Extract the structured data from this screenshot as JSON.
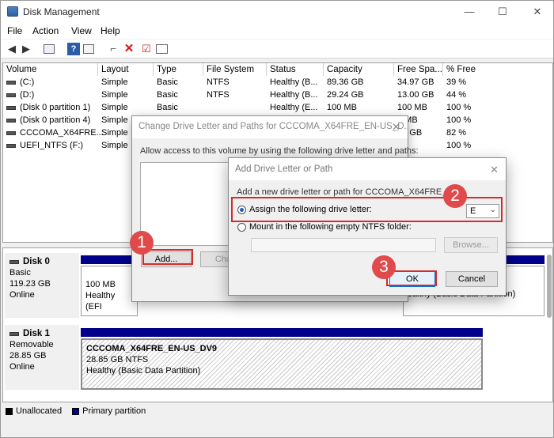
{
  "window": {
    "title": "Disk Management",
    "minimize": "—",
    "maximize": "☐",
    "close": "✕"
  },
  "menu": [
    "File",
    "Action",
    "View",
    "Help"
  ],
  "columns": [
    "Volume",
    "Layout",
    "Type",
    "File System",
    "Status",
    "Capacity",
    "Free Spa...",
    "% Free"
  ],
  "volumes": [
    {
      "volume": "(C:)",
      "layout": "Simple",
      "type": "Basic",
      "fs": "NTFS",
      "status": "Healthy (B...",
      "capacity": "89.36 GB",
      "free": "34.97 GB",
      "pct": "39 %"
    },
    {
      "volume": "(D:)",
      "layout": "Simple",
      "type": "Basic",
      "fs": "NTFS",
      "status": "Healthy (B...",
      "capacity": "29.24 GB",
      "free": "13.00 GB",
      "pct": "44 %"
    },
    {
      "volume": "(Disk 0 partition 1)",
      "layout": "Simple",
      "type": "Basic",
      "fs": "",
      "status": "Healthy (E...",
      "capacity": "100 MB",
      "free": "100 MB",
      "pct": "100 %"
    },
    {
      "volume": "(Disk 0 partition 4)",
      "layout": "Simple",
      "type": "",
      "fs": "",
      "status": "",
      "capacity": "",
      "free": "7 MB",
      "pct": "100 %"
    },
    {
      "volume": "CCCOMA_X64FRE...",
      "layout": "Simple",
      "type": "",
      "fs": "",
      "status": "",
      "capacity": "",
      "free": "55 GB",
      "pct": "82 %"
    },
    {
      "volume": "UEFI_NTFS (F:)",
      "layout": "Simple",
      "type": "",
      "fs": "",
      "status": "",
      "capacity": "",
      "free": "B",
      "pct": "100 %"
    }
  ],
  "disk0": {
    "name": "Disk 0",
    "type": "Basic",
    "size": "119.23 GB",
    "state": "Online",
    "part1_size": "100 MB",
    "part1_status": "Healthy (EFI",
    "part_right_status": "ealthy (Basic Data Partition)"
  },
  "disk1": {
    "name": "Disk 1",
    "type": "Removable",
    "size": "28.85 GB",
    "state": "Online",
    "vol_name": "CCCOMA_X64FRE_EN-US_DV9",
    "vol_size": "28.85 GB NTFS",
    "vol_status": "Healthy (Basic Data Partition)"
  },
  "legend": {
    "unallocated": "Unallocated",
    "primary": "Primary partition"
  },
  "change_dialog": {
    "title": "Change Drive Letter and Paths for CCCOMA_X64FRE_EN-US_D...",
    "close": "✕",
    "instruction": "Allow access to this volume by using the following drive letter and paths:",
    "add": "Add...",
    "change": "Chan"
  },
  "add_dialog": {
    "title": "Add Drive Letter or Path",
    "close": "✕",
    "instruction": "Add a new drive letter or path for CCCOMA_X64FRE_EN-US",
    "assign_label": "Assign the following drive letter:",
    "drive_letter": "E",
    "mount_label": "Mount in the following empty NTFS folder:",
    "browse": "Browse...",
    "ok": "OK",
    "cancel": "Cancel"
  },
  "steps": [
    "1",
    "2",
    "3"
  ],
  "colors": {
    "primary_partition": "#00008b",
    "callout": "#e14a4a",
    "highlight": "#d62b2b"
  }
}
